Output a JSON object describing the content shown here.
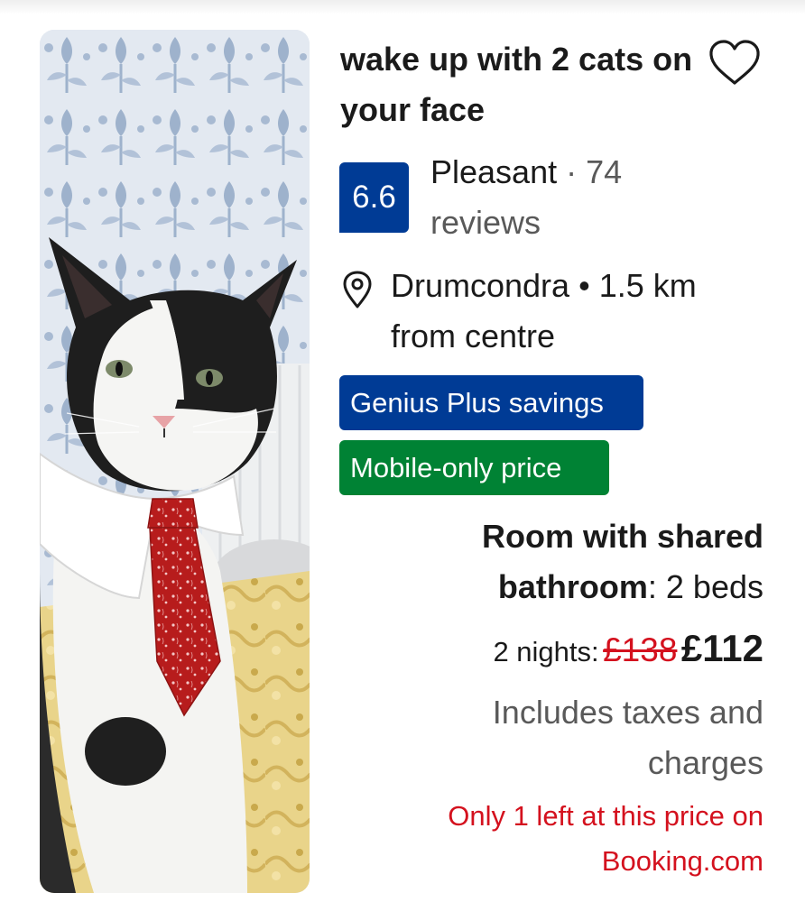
{
  "listing": {
    "title": "wake up with 2 cats on your face",
    "photo_alt": "Black and white cat wearing a white collar and red bandana-pattern tie",
    "favorite_icon": "heart-outline-icon"
  },
  "rating": {
    "score": "6.6",
    "word": "Pleasant",
    "separator": "·",
    "count": "74",
    "count_label": "reviews"
  },
  "location": {
    "icon": "map-pin-icon",
    "area": "Drumcondra",
    "separator": "•",
    "distance": "1.5 km from centre"
  },
  "badges": {
    "genius": "Genius Plus savings",
    "mobile": "Mobile-only price"
  },
  "room": {
    "name": "Room with shared bathroom",
    "beds": ": 2 beds"
  },
  "price": {
    "nights_label": "2 nights:",
    "original": "£138",
    "current": "£112",
    "taxes_note": "Includes taxes and charges"
  },
  "urgency": {
    "message": "Only 1 left at this price on Booking.com"
  },
  "colors": {
    "brand_blue": "#003b95",
    "green": "#008234",
    "alert_red": "#d4111e",
    "secondary_text": "#595959"
  }
}
